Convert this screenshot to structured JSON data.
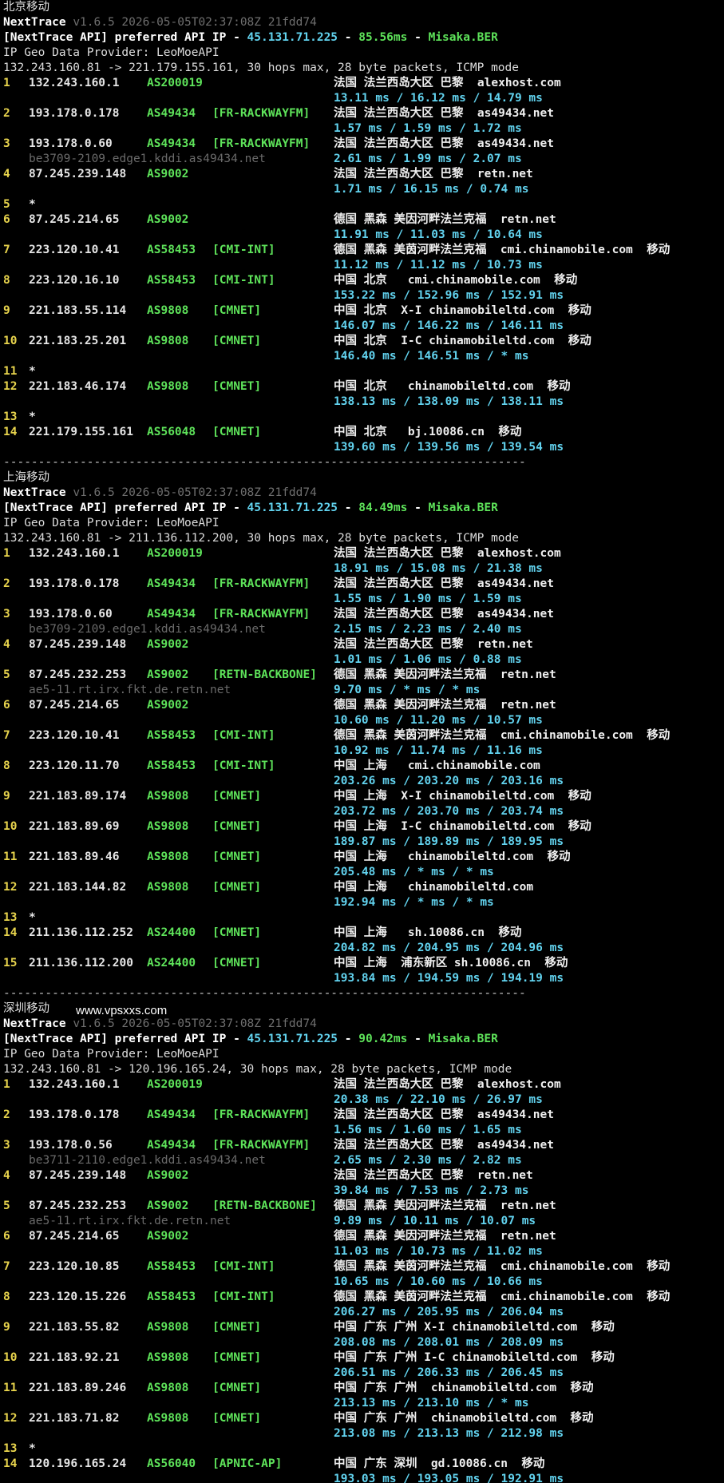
{
  "watermark": "www.vpsxxs.com",
  "divider": "---------------------------------------------------------------------------",
  "sections": [
    {
      "title": "北京移动",
      "app": "NextTrace",
      "version": "v1.6.5 2026-05-05T02:37:08Z 21fdd74",
      "api_prefix": "[NextTrace API] preferred API IP - ",
      "api_ip": "45.131.71.225",
      "api_sep": " - ",
      "api_latency": "85.56ms",
      "api_pop": "Misaka.BER",
      "geo_provider": "IP Geo Data Provider: LeoMoeAPI",
      "trace_line": "132.243.160.81 -> 221.179.155.161, 30 hops max, 28 byte packets, ICMP mode",
      "hops": [
        {
          "n": "1",
          "ip": "132.243.160.1",
          "as": "AS200019",
          "tag": "",
          "geo": "法国 法兰西岛大区 巴黎  alexhost.com",
          "rtt": "13.11 ms / 16.12 ms / 14.79 ms"
        },
        {
          "n": "2",
          "ip": "193.178.0.178",
          "as": "AS49434",
          "tag": "[FR-RACKWAYFM]",
          "geo": "法国 法兰西岛大区 巴黎  as49434.net",
          "rtt": "1.57 ms / 1.59 ms / 1.72 ms"
        },
        {
          "n": "3",
          "ip": "193.178.0.60",
          "as": "AS49434",
          "tag": "[FR-RACKWAYFM]",
          "geo": "法国 法兰西岛大区 巴黎  as49434.net",
          "rdns": "be3709-2109.edge1.kddi.as49434.net",
          "rtt": "2.61 ms / 1.99 ms / 2.07 ms"
        },
        {
          "n": "4",
          "ip": "87.245.239.148",
          "as": "AS9002",
          "tag": "",
          "geo": "法国 法兰西岛大区 巴黎  retn.net",
          "rtt": "1.71 ms / 16.15 ms / 0.74 ms"
        },
        {
          "n": "5",
          "ip": "*",
          "blank": true
        },
        {
          "n": "6",
          "ip": "87.245.214.65",
          "as": "AS9002",
          "tag": "",
          "geo": "德国 黑森 美因河畔法兰克福  retn.net",
          "rtt": "11.91 ms / 11.03 ms / 10.64 ms"
        },
        {
          "n": "7",
          "ip": "223.120.10.41",
          "as": "AS58453",
          "tag": "[CMI-INT]",
          "geo": "德国 黑森 美茵河畔法兰克福  cmi.chinamobile.com  移动",
          "rtt": "11.12 ms / 11.12 ms / 10.73 ms"
        },
        {
          "n": "8",
          "ip": "223.120.16.10",
          "as": "AS58453",
          "tag": "[CMI-INT]",
          "geo": "中国 北京   cmi.chinamobile.com  移动",
          "rtt": "153.22 ms / 152.96 ms / 152.91 ms"
        },
        {
          "n": "9",
          "ip": "221.183.55.114",
          "as": "AS9808",
          "tag": "[CMNET]",
          "geo": "中国 北京  X-I chinamobileltd.com  移动",
          "rtt": "146.07 ms / 146.22 ms / 146.11 ms"
        },
        {
          "n": "10",
          "ip": "221.183.25.201",
          "as": "AS9808",
          "tag": "[CMNET]",
          "geo": "中国 北京  I-C chinamobileltd.com  移动",
          "rtt": "146.40 ms / 146.51 ms / * ms"
        },
        {
          "n": "11",
          "ip": "*",
          "blank": true
        },
        {
          "n": "12",
          "ip": "221.183.46.174",
          "as": "AS9808",
          "tag": "[CMNET]",
          "geo": "中国 北京   chinamobileltd.com  移动",
          "rtt": "138.13 ms / 138.09 ms / 138.11 ms"
        },
        {
          "n": "13",
          "ip": "*",
          "blank": true
        },
        {
          "n": "14",
          "ip": "221.179.155.161",
          "as": "AS56048",
          "tag": "[CMNET]",
          "geo": "中国 北京   bj.10086.cn  移动",
          "rtt": "139.60 ms / 139.56 ms / 139.54 ms"
        }
      ]
    },
    {
      "title": "上海移动",
      "app": "NextTrace",
      "version": "v1.6.5 2026-05-05T02:37:08Z 21fdd74",
      "api_prefix": "[NextTrace API] preferred API IP - ",
      "api_ip": "45.131.71.225",
      "api_sep": " - ",
      "api_latency": "84.49ms",
      "api_pop": "Misaka.BER",
      "geo_provider": "IP Geo Data Provider: LeoMoeAPI",
      "trace_line": "132.243.160.81 -> 211.136.112.200, 30 hops max, 28 byte packets, ICMP mode",
      "hops": [
        {
          "n": "1",
          "ip": "132.243.160.1",
          "as": "AS200019",
          "tag": "",
          "geo": "法国 法兰西岛大区 巴黎  alexhost.com",
          "rtt": "18.91 ms / 15.08 ms / 21.38 ms"
        },
        {
          "n": "2",
          "ip": "193.178.0.178",
          "as": "AS49434",
          "tag": "[FR-RACKWAYFM]",
          "geo": "法国 法兰西岛大区 巴黎  as49434.net",
          "rtt": "1.55 ms / 1.90 ms / 1.59 ms"
        },
        {
          "n": "3",
          "ip": "193.178.0.60",
          "as": "AS49434",
          "tag": "[FR-RACKWAYFM]",
          "geo": "法国 法兰西岛大区 巴黎  as49434.net",
          "rdns": "be3709-2109.edge1.kddi.as49434.net",
          "rtt": "2.15 ms / 2.23 ms / 2.40 ms"
        },
        {
          "n": "4",
          "ip": "87.245.239.148",
          "as": "AS9002",
          "tag": "",
          "geo": "法国 法兰西岛大区 巴黎  retn.net",
          "rtt": "1.01 ms / 1.06 ms / 0.88 ms"
        },
        {
          "n": "5",
          "ip": "87.245.232.253",
          "as": "AS9002",
          "tag": "[RETN-BACKBONE]",
          "geo": "德国 黑森 美因河畔法兰克福  retn.net",
          "rdns": "ae5-11.rt.irx.fkt.de.retn.net",
          "rtt": "9.70 ms / * ms / * ms"
        },
        {
          "n": "6",
          "ip": "87.245.214.65",
          "as": "AS9002",
          "tag": "",
          "geo": "德国 黑森 美因河畔法兰克福  retn.net",
          "rtt": "10.60 ms / 11.20 ms / 10.57 ms"
        },
        {
          "n": "7",
          "ip": "223.120.10.41",
          "as": "AS58453",
          "tag": "[CMI-INT]",
          "geo": "德国 黑森 美茵河畔法兰克福  cmi.chinamobile.com  移动",
          "rtt": "10.92 ms / 11.74 ms / 11.16 ms"
        },
        {
          "n": "8",
          "ip": "223.120.11.70",
          "as": "AS58453",
          "tag": "[CMI-INT]",
          "geo": "中国 上海   cmi.chinamobile.com",
          "rtt": "203.26 ms / 203.20 ms / 203.16 ms"
        },
        {
          "n": "9",
          "ip": "221.183.89.174",
          "as": "AS9808",
          "tag": "[CMNET]",
          "geo": "中国 上海  X-I chinamobileltd.com  移动",
          "rtt": "203.72 ms / 203.70 ms / 203.74 ms"
        },
        {
          "n": "10",
          "ip": "221.183.89.69",
          "as": "AS9808",
          "tag": "[CMNET]",
          "geo": "中国 上海  I-C chinamobileltd.com  移动",
          "rtt": "189.87 ms / 189.89 ms / 189.95 ms"
        },
        {
          "n": "11",
          "ip": "221.183.89.46",
          "as": "AS9808",
          "tag": "[CMNET]",
          "geo": "中国 上海   chinamobileltd.com  移动",
          "rtt": "205.48 ms / * ms / * ms"
        },
        {
          "n": "12",
          "ip": "221.183.144.82",
          "as": "AS9808",
          "tag": "[CMNET]",
          "geo": "中国 上海   chinamobileltd.com",
          "rtt": "192.94 ms / * ms / * ms"
        },
        {
          "n": "13",
          "ip": "*",
          "blank": true
        },
        {
          "n": "14",
          "ip": "211.136.112.252",
          "as": "AS24400",
          "tag": "[CMNET]",
          "geo": "中国 上海   sh.10086.cn  移动",
          "rtt": "204.82 ms / 204.95 ms / 204.96 ms"
        },
        {
          "n": "15",
          "ip": "211.136.112.200",
          "as": "AS24400",
          "tag": "[CMNET]",
          "geo": "中国 上海  浦东新区 sh.10086.cn  移动",
          "rtt": "193.84 ms / 194.59 ms / 194.19 ms"
        }
      ]
    },
    {
      "title": "深圳移动",
      "app": "NextTrace",
      "version": "v1.6.5 2026-05-05T02:37:08Z 21fdd74",
      "api_prefix": "[NextTrace API] preferred API IP - ",
      "api_ip": "45.131.71.225",
      "api_sep": " - ",
      "api_latency": "90.42ms",
      "api_pop": "Misaka.BER",
      "geo_provider": "IP Geo Data Provider: LeoMoeAPI",
      "trace_line": "132.243.160.81 -> 120.196.165.24, 30 hops max, 28 byte packets, ICMP mode",
      "hops": [
        {
          "n": "1",
          "ip": "132.243.160.1",
          "as": "AS200019",
          "tag": "",
          "geo": "法国 法兰西岛大区 巴黎  alexhost.com",
          "rtt": "20.38 ms / 22.10 ms / 26.97 ms"
        },
        {
          "n": "2",
          "ip": "193.178.0.178",
          "as": "AS49434",
          "tag": "[FR-RACKWAYFM]",
          "geo": "法国 法兰西岛大区 巴黎  as49434.net",
          "rtt": "1.56 ms / 1.60 ms / 1.65 ms"
        },
        {
          "n": "3",
          "ip": "193.178.0.56",
          "as": "AS49434",
          "tag": "[FR-RACKWAYFM]",
          "geo": "法国 法兰西岛大区 巴黎  as49434.net",
          "rdns": "be3711-2110.edge1.kddi.as49434.net",
          "rtt": "2.65 ms / 2.30 ms / 2.82 ms"
        },
        {
          "n": "4",
          "ip": "87.245.239.148",
          "as": "AS9002",
          "tag": "",
          "geo": "法国 法兰西岛大区 巴黎  retn.net",
          "rtt": "39.84 ms / 7.53 ms / 2.73 ms"
        },
        {
          "n": "5",
          "ip": "87.245.232.253",
          "as": "AS9002",
          "tag": "[RETN-BACKBONE]",
          "geo": "德国 黑森 美因河畔法兰克福  retn.net",
          "rdns": "ae5-11.rt.irx.fkt.de.retn.net",
          "rtt": "9.89 ms / 10.11 ms / 10.07 ms"
        },
        {
          "n": "6",
          "ip": "87.245.214.65",
          "as": "AS9002",
          "tag": "",
          "geo": "德国 黑森 美因河畔法兰克福  retn.net",
          "rtt": "11.03 ms / 10.73 ms / 11.02 ms"
        },
        {
          "n": "7",
          "ip": "223.120.10.85",
          "as": "AS58453",
          "tag": "[CMI-INT]",
          "geo": "德国 黑森 美茵河畔法兰克福  cmi.chinamobile.com  移动",
          "rtt": "10.65 ms / 10.60 ms / 10.66 ms"
        },
        {
          "n": "8",
          "ip": "223.120.15.226",
          "as": "AS58453",
          "tag": "[CMI-INT]",
          "geo": "德国 黑森 美茵河畔法兰克福  cmi.chinamobile.com  移动",
          "rtt": "206.27 ms / 205.95 ms / 206.04 ms"
        },
        {
          "n": "9",
          "ip": "221.183.55.82",
          "as": "AS9808",
          "tag": "[CMNET]",
          "geo": "中国 广东 广州 X-I chinamobileltd.com  移动",
          "rtt": "208.08 ms / 208.01 ms / 208.09 ms"
        },
        {
          "n": "10",
          "ip": "221.183.92.21",
          "as": "AS9808",
          "tag": "[CMNET]",
          "geo": "中国 广东 广州 I-C chinamobileltd.com  移动",
          "rtt": "206.51 ms / 206.33 ms / 206.45 ms"
        },
        {
          "n": "11",
          "ip": "221.183.89.246",
          "as": "AS9808",
          "tag": "[CMNET]",
          "geo": "中国 广东 广州  chinamobileltd.com  移动",
          "rtt": "213.13 ms / 213.10 ms / * ms"
        },
        {
          "n": "12",
          "ip": "221.183.71.82",
          "as": "AS9808",
          "tag": "[CMNET]",
          "geo": "中国 广东 广州  chinamobileltd.com  移动",
          "rtt": "213.08 ms / 213.13 ms / 212.98 ms"
        },
        {
          "n": "13",
          "ip": "*",
          "blank": true
        },
        {
          "n": "14",
          "ip": "120.196.165.24",
          "as": "AS56040",
          "tag": "[APNIC-AP]",
          "geo": "中国 广东 深圳  gd.10086.cn  移动",
          "rtt": "193.03 ms / 193.05 ms / 192.91 ms"
        }
      ]
    }
  ]
}
